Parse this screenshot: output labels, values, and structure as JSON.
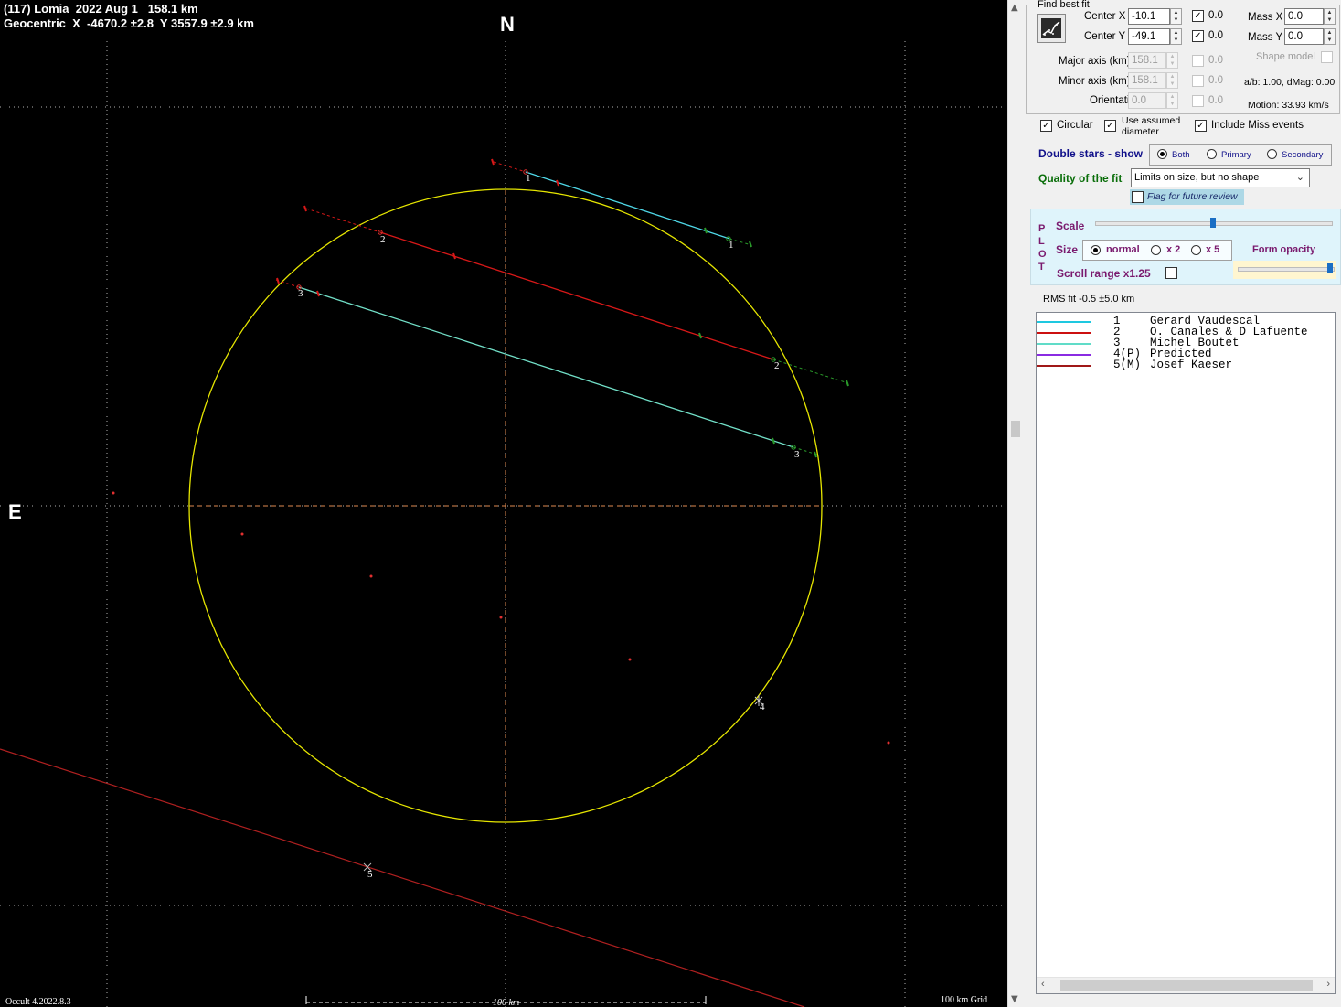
{
  "plot": {
    "header_line1": "(117) Lomia  2022 Aug 1   158.1 km",
    "header_line2": "Geocentric  X  -4670.2 ±2.8  Y 3557.9 ±2.9 km",
    "north_label": "N",
    "east_label": "E",
    "footer_version": "Occult 4.2022.8.3",
    "scale_bar_label": "100 km",
    "grid_label": "100 km Grid",
    "colors": {
      "background": "#000000",
      "ellipse": "#e6e600",
      "chord_1": "#4fd8e8",
      "chord_2": "#d81818",
      "chord_3": "#72e0c8",
      "chord_5": "#b02020",
      "miss_dot": "#e23030",
      "axes": "#e08a50",
      "grid": "#b0b0b0"
    },
    "chord_labels": [
      "1",
      "1",
      "2",
      "2",
      "3",
      "3",
      "4",
      "5"
    ]
  },
  "panel": {
    "find_best_fit_label": "Find best fit",
    "fit_icon": "fit-chart-icon",
    "center_x": {
      "label": "Center X",
      "value": "-10.1",
      "check": "0.0",
      "checked": true
    },
    "center_y": {
      "label": "Center Y",
      "value": "-49.1",
      "check": "0.0",
      "checked": true
    },
    "mass_x": {
      "label": "Mass X",
      "value": "0.0"
    },
    "mass_y": {
      "label": "Mass Y",
      "value": "0.0"
    },
    "major_axis": {
      "label": "Major axis (km)",
      "value": "158.1",
      "check": "0.0"
    },
    "minor_axis": {
      "label": "Minor axis (km)",
      "value": "158.1",
      "check": "0.0"
    },
    "orientation": {
      "label": "Orientation",
      "value": "0.0",
      "check": "0.0"
    },
    "shape_model_label": "Shape model",
    "ab_text": "a/b: 1.00, dMag: 0.00",
    "motion_text": "Motion: 33.93 km/s",
    "circular_label": "Circular",
    "use_assumed_label_1": "Use assumed",
    "use_assumed_label_2": "diameter",
    "include_miss_label": "Include Miss events",
    "double_stars_label": "Double stars - show",
    "double_options": [
      "Both",
      "Primary",
      "Secondary"
    ],
    "double_selected": "Both",
    "quality_label": "Quality of the fit",
    "quality_value": "Limits on size, but no shape",
    "flag_label": "Flag for future review",
    "plot_vertical_label": [
      "P",
      "L",
      "O",
      "T"
    ],
    "scale_label": "Scale",
    "scale_level": 0.5,
    "size_label": "Size",
    "size_options": [
      "normal",
      "x 2",
      "x 5"
    ],
    "size_selected": "normal",
    "form_opacity_label": "Form opacity",
    "form_opacity_level": 1.0,
    "scroll_range_label": "Scroll range x1.25",
    "rms_text": "RMS fit -0.5 ±5.0 km",
    "legend": [
      {
        "id": "1",
        "name": "Gerard Vaudescal",
        "color": "#1ec8e0"
      },
      {
        "id": "2",
        "name": "O. Canales & D Lafuente",
        "color": "#cc1010"
      },
      {
        "id": "3",
        "name": "Michel Boutet",
        "color": "#60dcc8"
      },
      {
        "id": "4(P)",
        "name": "Predicted",
        "color": "#8a2be2"
      },
      {
        "id": "5(M)",
        "name": "Josef Kaeser",
        "color": "#a01818"
      }
    ]
  }
}
